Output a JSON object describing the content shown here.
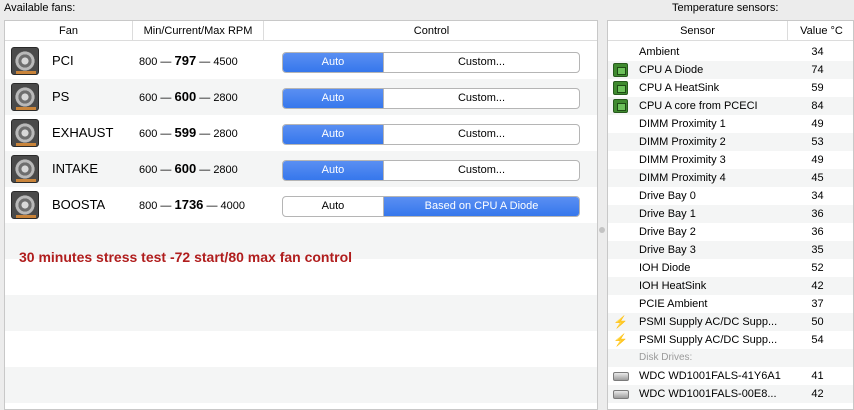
{
  "fans_title": "Available fans:",
  "temps_title": "Temperature sensors:",
  "fan_headers": {
    "fan": "Fan",
    "rpm": "Min/Current/Max RPM",
    "control": "Control"
  },
  "fans": [
    {
      "name": "PCI",
      "min": "800",
      "current": "797",
      "max": "4500",
      "auto_label": "Auto",
      "control_label": "Custom...",
      "mode": "auto"
    },
    {
      "name": "PS",
      "min": "600",
      "current": "600",
      "max": "2800",
      "auto_label": "Auto",
      "control_label": "Custom...",
      "mode": "auto"
    },
    {
      "name": "EXHAUST",
      "min": "600",
      "current": "599",
      "max": "2800",
      "auto_label": "Auto",
      "control_label": "Custom...",
      "mode": "auto"
    },
    {
      "name": "INTAKE",
      "min": "600",
      "current": "600",
      "max": "2800",
      "auto_label": "Auto",
      "control_label": "Custom...",
      "mode": "auto"
    },
    {
      "name": "BOOSTA",
      "min": "800",
      "current": "1736",
      "max": "4000",
      "auto_label": "Auto",
      "control_label": "Based on CPU A Diode",
      "mode": "sensor"
    }
  ],
  "rpm_dash": "—",
  "annotation": "30 minutes stress test -72 start/80 max fan control",
  "annotation_color": "#b01d1d",
  "accent_color": "#3677ec",
  "sensor_headers": {
    "sensor": "Sensor",
    "value": "Value °C"
  },
  "sensors": [
    {
      "icon": "none",
      "name": "Ambient",
      "value": "34"
    },
    {
      "icon": "chip-icon",
      "name": "CPU A Diode",
      "value": "74"
    },
    {
      "icon": "chip-icon",
      "name": "CPU A HeatSink",
      "value": "59"
    },
    {
      "icon": "chip-icon",
      "name": "CPU A core from PCECI",
      "value": "84"
    },
    {
      "icon": "none",
      "name": "DIMM Proximity 1",
      "value": "49"
    },
    {
      "icon": "none",
      "name": "DIMM Proximity 2",
      "value": "53"
    },
    {
      "icon": "none",
      "name": "DIMM Proximity 3",
      "value": "49"
    },
    {
      "icon": "none",
      "name": "DIMM Proximity 4",
      "value": "45"
    },
    {
      "icon": "none",
      "name": "Drive Bay 0",
      "value": "34"
    },
    {
      "icon": "none",
      "name": "Drive Bay 1",
      "value": "36"
    },
    {
      "icon": "none",
      "name": "Drive Bay 2",
      "value": "36"
    },
    {
      "icon": "none",
      "name": "Drive Bay 3",
      "value": "35"
    },
    {
      "icon": "none",
      "name": "IOH Diode",
      "value": "52"
    },
    {
      "icon": "none",
      "name": "IOH HeatSink",
      "value": "42"
    },
    {
      "icon": "none",
      "name": "PCIE Ambient",
      "value": "37"
    },
    {
      "icon": "bolt-icon",
      "name": "PSMI Supply AC/DC Supp...",
      "value": "50"
    },
    {
      "icon": "bolt-icon",
      "name": "PSMI Supply AC/DC Supp...",
      "value": "54"
    }
  ],
  "disk_group_label": "Disk Drives:",
  "disks": [
    {
      "icon": "drive-icon",
      "name": "WDC WD1001FALS-41Y6A1",
      "value": "41"
    },
    {
      "icon": "drive-icon",
      "name": "WDC WD1001FALS-00E8...",
      "value": "42"
    }
  ]
}
